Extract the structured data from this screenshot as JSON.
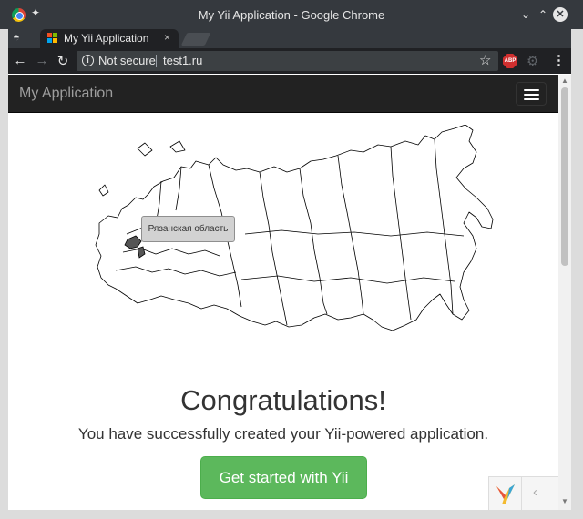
{
  "window": {
    "title": "My Yii Application - Google Chrome"
  },
  "tabs": [
    {
      "label": "My Yii Application",
      "close_glyph": "×"
    }
  ],
  "toolbar": {
    "back_glyph": "←",
    "forward_glyph": "→",
    "reload_glyph": "↻",
    "security_label": "Not secure",
    "url": "test1.ru",
    "star_glyph": "☆",
    "abp_label": "ABP",
    "menu_glyph": "⋮"
  },
  "navbar": {
    "brand": "My Application"
  },
  "map": {
    "tooltip": "Рязанская область"
  },
  "hero": {
    "title": "Congratulations!",
    "lead": "You have successfully created your Yii-powered application.",
    "cta_label": "Get started with Yii"
  },
  "debug": {
    "chevron": "‹"
  },
  "colors": {
    "navbar_bg": "#222222",
    "cta_bg": "#5cb85c",
    "region_highlight": "#555555"
  }
}
